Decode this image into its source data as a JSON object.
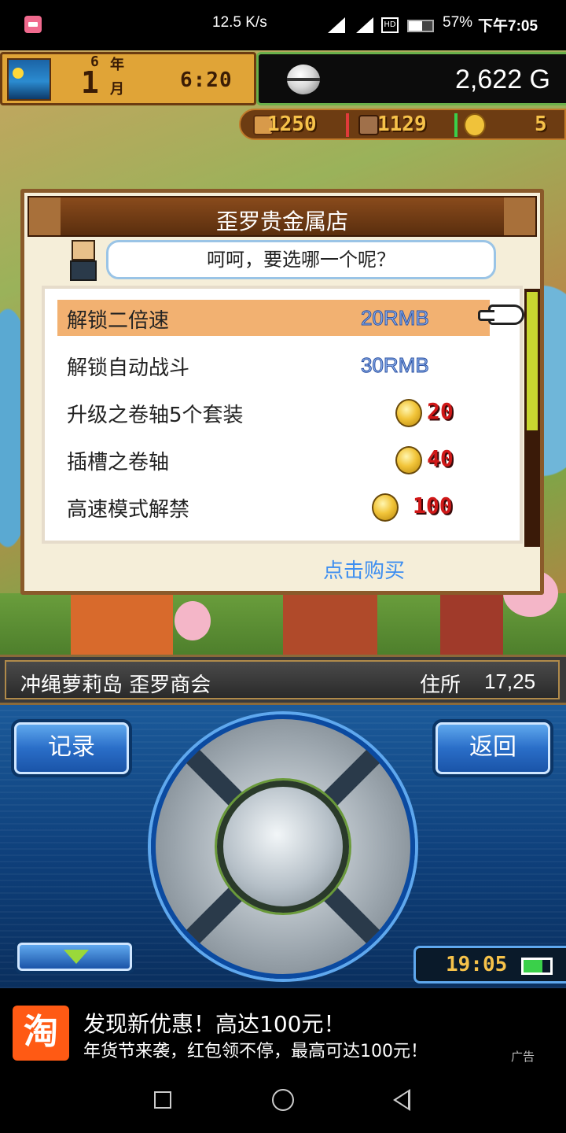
{
  "status_bar": {
    "app_icon": "bilibili-icon",
    "net_speed": "12.5 K/s",
    "icons": [
      "bluetooth-icon",
      "mute-icon",
      "signal-4g-icon",
      "signal-4g-icon",
      "hd-icon",
      "battery-icon"
    ],
    "hd_label": "HD",
    "battery_percent": "57%",
    "battery_level": 0.57,
    "time": "下午7:05"
  },
  "hud": {
    "year_num": "6",
    "year_label": "年",
    "month_num": "1",
    "month_label": "月",
    "time": "6:20",
    "money": "2,622 G",
    "resources": {
      "r1": "1250",
      "r2": "1129",
      "r3": "5"
    }
  },
  "shop": {
    "title": "歪罗贵金属店",
    "greeting": "呵呵，要选哪一个呢？",
    "items": [
      {
        "name": "解锁二倍速",
        "price": "20RMB"
      },
      {
        "name": "解锁自动战斗",
        "price": "30RMB"
      },
      {
        "name": "升级之卷轴5个套装",
        "coins": "20"
      },
      {
        "name": "插槽之卷轴",
        "coins": "40"
      },
      {
        "name": "高速模式解禁",
        "coins": "100"
      }
    ],
    "buy_label": "点击购买"
  },
  "location": {
    "place": "冲绳萝莉岛 歪罗商会",
    "addr_label": "住所",
    "addr_value": "17,25"
  },
  "controls": {
    "record_label": "记录",
    "back_label": "返回",
    "clock": "19:05"
  },
  "ad": {
    "logo_char": "淘",
    "title": "发现新优惠！高达100元！",
    "subtitle": "年货节来袭，红包领不停，最高可达100元！",
    "tag": "广告"
  },
  "colors": {
    "selected_row": "#f2b171",
    "link_blue": "#3d8ef0",
    "coin_red": "#d01818",
    "controller_blue": "#1b5a9a",
    "taobao_orange": "#ff5a14"
  }
}
